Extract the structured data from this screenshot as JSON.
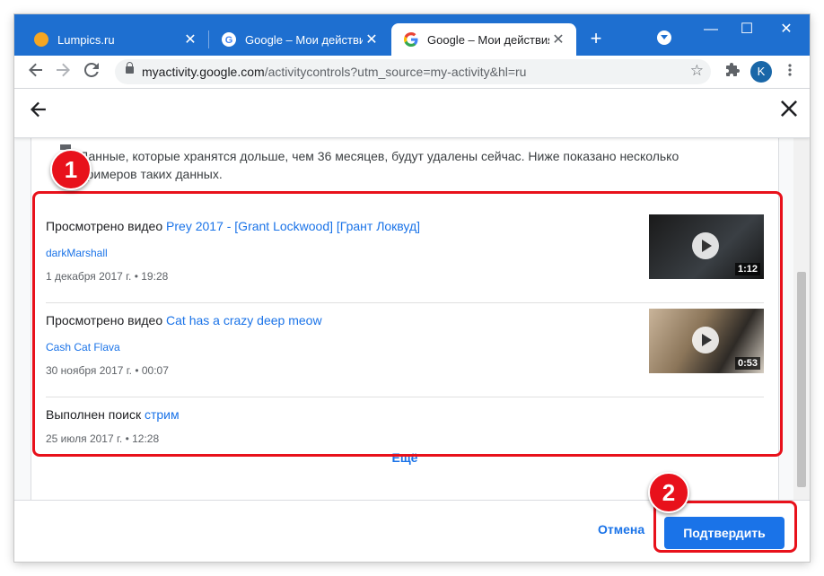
{
  "tabs": [
    {
      "title": "Lumpics.ru",
      "close": "✕",
      "favicon_color": "#f5a623"
    },
    {
      "title": "Google – Мои действия",
      "close": "✕"
    },
    {
      "title": "Google – Мои действия",
      "close": "✕"
    }
  ],
  "titlebar": {
    "new_tab": "+",
    "minimize": "—",
    "maximize": "☐",
    "close": "✕",
    "accent": "#1e6fd0"
  },
  "toolbar": {
    "url_host": "myactivity.google.com",
    "url_rest": "/activitycontrols?utm_source=my-activity&hl=ru",
    "avatar_letter": "K",
    "icons": [
      "back-arrow-icon",
      "forward-arrow-icon",
      "reload-icon",
      "lock-icon",
      "star-icon",
      "extensions-icon",
      "menu-dots-icon"
    ]
  },
  "dialog": {
    "notice": "Данные, которые хранятся дольше, чем 36 месяцев, будут удалены сейчас. Ниже показано несколько примеров таких данных.",
    "items": [
      {
        "action": "Просмотрено видео",
        "link": "Prey 2017 - [Grant Lockwood] [Грант Локвуд]",
        "channel": "darkMarshall",
        "date": "1 декабря 2017 г. • 19:28",
        "duration": "1:12"
      },
      {
        "action": "Просмотрено видео",
        "link": "Cat has a crazy deep meow",
        "channel": "Cash Cat Flava",
        "date": "30 ноября 2017 г. • 00:07",
        "duration": "0:53"
      },
      {
        "action": "Выполнен поиск",
        "link": "стрим",
        "date": "25 июля 2017 г. • 12:28"
      }
    ],
    "more": "Ещё",
    "cancel": "Отмена",
    "confirm": "Подтвердить"
  },
  "annotations": {
    "badge1": "1",
    "badge2": "2",
    "highlight_color": "#e8111b"
  }
}
